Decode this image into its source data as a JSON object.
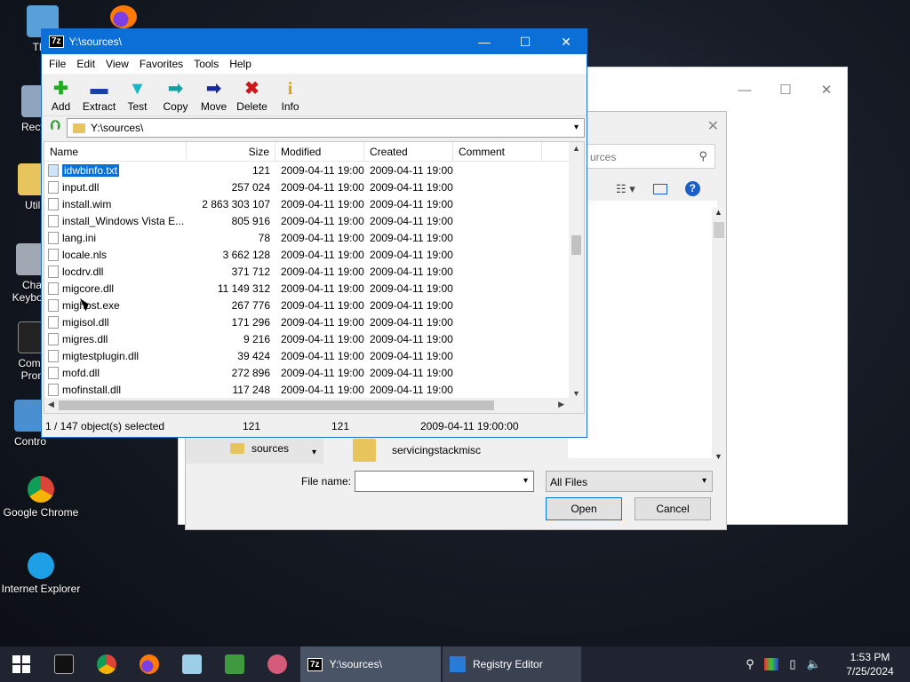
{
  "desktop": {
    "icons": [
      {
        "label": "This",
        "color": "#5aa0d8"
      },
      {
        "label": "Recycl",
        "color": "#8fa4bd"
      },
      {
        "label": "Utili",
        "color": "#e8c45c"
      },
      {
        "label": "Cha\nKeyboar",
        "color": "#a0a8b4"
      },
      {
        "label": "Comm\nProm",
        "color": "#222"
      },
      {
        "label": "Contro",
        "color": "#4a90d0"
      },
      {
        "label": "Google Chrome",
        "color": "#db4437"
      },
      {
        "label": "Internet Explorer",
        "color": "#1ea0e6"
      }
    ]
  },
  "bg_window": {
    "min": "—",
    "max": "☐",
    "close": "✕"
  },
  "dialog": {
    "close": "✕",
    "search_placeholder": "urces",
    "nav_item": "sources",
    "folder_item": "servicingstackmisc",
    "file_name_label": "File name:",
    "file_name_value": "",
    "file_type": "All Files",
    "open_label": "Open",
    "cancel_label": "Cancel",
    "help": "?"
  },
  "zip": {
    "logo": "7z",
    "title": "Y:\\sources\\",
    "menu": [
      "File",
      "Edit",
      "View",
      "Favorites",
      "Tools",
      "Help"
    ],
    "toolbar": [
      {
        "label": "Add",
        "glyph": "✚",
        "color": "#22aa22"
      },
      {
        "label": "Extract",
        "glyph": "▬",
        "color": "#1a3fa8"
      },
      {
        "label": "Test",
        "glyph": "▼",
        "color": "#18b5c4"
      },
      {
        "label": "Copy",
        "glyph": "➡",
        "color": "#18a0a0"
      },
      {
        "label": "Move",
        "glyph": "➡",
        "color": "#1a2a9a"
      },
      {
        "label": "Delete",
        "glyph": "✖",
        "color": "#cc1818"
      },
      {
        "label": "Info",
        "glyph": "i",
        "color": "#d8a800"
      }
    ],
    "address": "Y:\\sources\\",
    "columns": [
      "Name",
      "Size",
      "Modified",
      "Created",
      "Comment"
    ],
    "files": [
      {
        "name": "idwbinfo.txt",
        "size": "121",
        "modified": "2009-04-11 19:00",
        "created": "2009-04-11 19:00",
        "selected": true
      },
      {
        "name": "input.dll",
        "size": "257 024",
        "modified": "2009-04-11 19:00",
        "created": "2009-04-11 19:00"
      },
      {
        "name": "install.wim",
        "size": "2 863 303 107",
        "modified": "2009-04-11 19:00",
        "created": "2009-04-11 19:00"
      },
      {
        "name": "install_Windows Vista E...",
        "size": "805 916",
        "modified": "2009-04-11 19:00",
        "created": "2009-04-11 19:00"
      },
      {
        "name": "lang.ini",
        "size": "78",
        "modified": "2009-04-11 19:00",
        "created": "2009-04-11 19:00"
      },
      {
        "name": "locale.nls",
        "size": "3 662 128",
        "modified": "2009-04-11 19:00",
        "created": "2009-04-11 19:00"
      },
      {
        "name": "locdrv.dll",
        "size": "371 712",
        "modified": "2009-04-11 19:00",
        "created": "2009-04-11 19:00"
      },
      {
        "name": "migcore.dll",
        "size": "11 149 312",
        "modified": "2009-04-11 19:00",
        "created": "2009-04-11 19:00"
      },
      {
        "name": "mighost.exe",
        "size": "267 776",
        "modified": "2009-04-11 19:00",
        "created": "2009-04-11 19:00"
      },
      {
        "name": "migisol.dll",
        "size": "171 296",
        "modified": "2009-04-11 19:00",
        "created": "2009-04-11 19:00"
      },
      {
        "name": "migres.dll",
        "size": "9 216",
        "modified": "2009-04-11 19:00",
        "created": "2009-04-11 19:00"
      },
      {
        "name": "migtestplugin.dll",
        "size": "39 424",
        "modified": "2009-04-11 19:00",
        "created": "2009-04-11 19:00"
      },
      {
        "name": "mofd.dll",
        "size": "272 896",
        "modified": "2009-04-11 19:00",
        "created": "2009-04-11 19:00"
      },
      {
        "name": "mofinstall.dll",
        "size": "117 248",
        "modified": "2009-04-11 19:00",
        "created": "2009-04-11 19:00"
      }
    ],
    "status": {
      "selection": "1 / 147 object(s) selected",
      "size": "121",
      "packed": "121",
      "modified": "2009-04-11 19:00:00"
    }
  },
  "taskbar": {
    "active_task": "Y:\\sources\\",
    "other_task": "Registry Editor",
    "time": "1:53 PM",
    "date": "7/25/2024"
  }
}
